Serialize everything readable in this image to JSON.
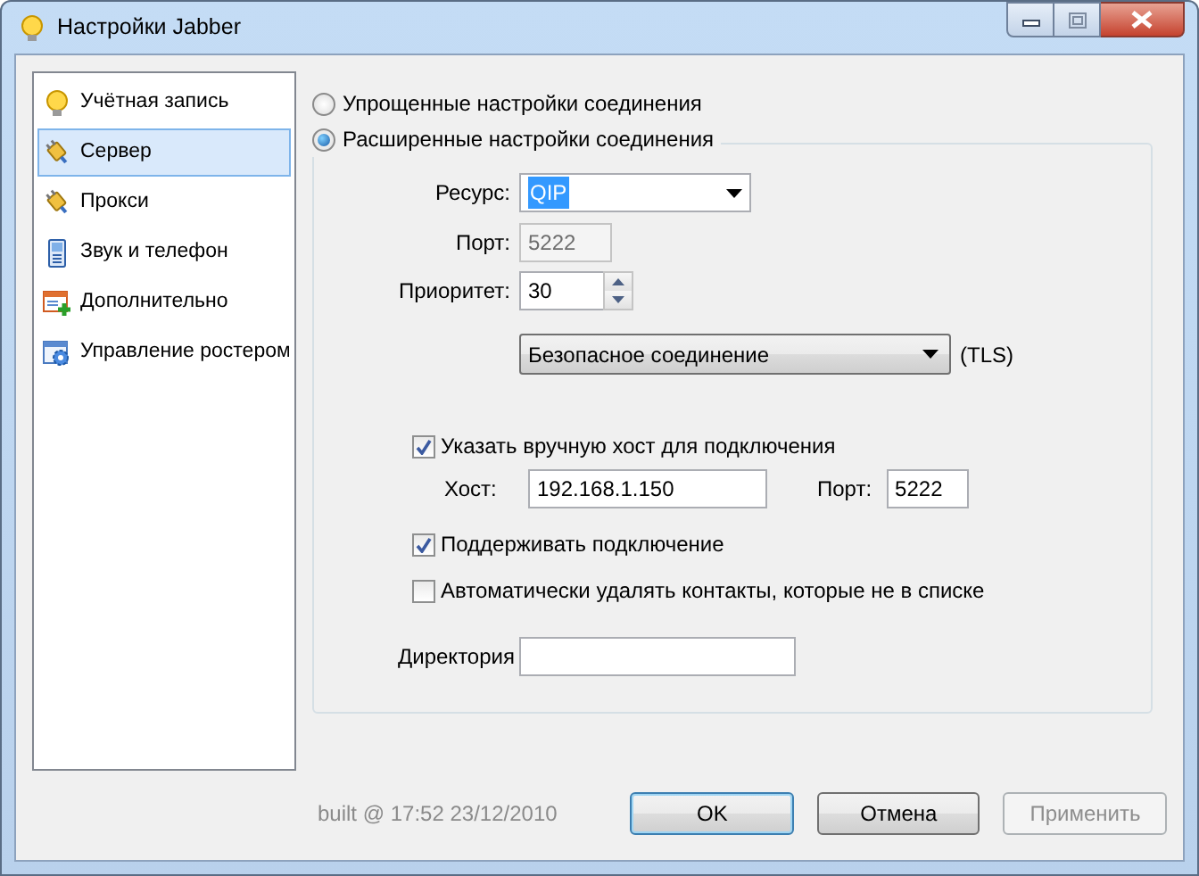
{
  "window": {
    "title": "Настройки Jabber"
  },
  "sidebar": {
    "items": [
      {
        "label": "Учётная запись",
        "kind": "bulb",
        "selected": false
      },
      {
        "label": "Сервер",
        "kind": "plug",
        "selected": true
      },
      {
        "label": "Прокси",
        "kind": "plug",
        "selected": false
      },
      {
        "label": "Звук и телефон",
        "kind": "phone",
        "selected": false
      },
      {
        "label": "Дополнительно",
        "kind": "addwindow",
        "selected": false
      },
      {
        "label": "Управление ростером",
        "kind": "gearwindow",
        "selected": false
      }
    ]
  },
  "connection_modes": [
    {
      "label": "Упрощенные настройки соединения",
      "selected": false
    },
    {
      "label": "Расширенные настройки соединения",
      "selected": true
    }
  ],
  "advanced": {
    "resource": {
      "label": "Ресурс:",
      "value": "QIP"
    },
    "port": {
      "label": "Порт:",
      "value": "5222",
      "disabled": true
    },
    "priority": {
      "label": "Приоритет:",
      "value": "30"
    },
    "security": {
      "value": "Безопасное соединение",
      "note": "(TLS)"
    },
    "manual_host": {
      "label": "Указать вручную хост для подключения",
      "checked": true
    },
    "host": {
      "label": "Хост:",
      "value": "192.168.1.150"
    },
    "host_port": {
      "label": "Порт:",
      "value": "5222"
    },
    "keep_alive": {
      "label": "Поддерживать подключение",
      "checked": true
    },
    "auto_remove": {
      "label": "Автоматически удалять контакты, которые не в списке",
      "checked": false
    },
    "directory": {
      "label": "Директория"
    }
  },
  "build_info": "built @ 17:52 23/12/2010",
  "buttons": [
    {
      "label": "OK",
      "default": true,
      "disabled": false
    },
    {
      "label": "Отмена",
      "default": false,
      "disabled": false
    },
    {
      "label": "Применить",
      "default": false,
      "disabled": true
    }
  ]
}
